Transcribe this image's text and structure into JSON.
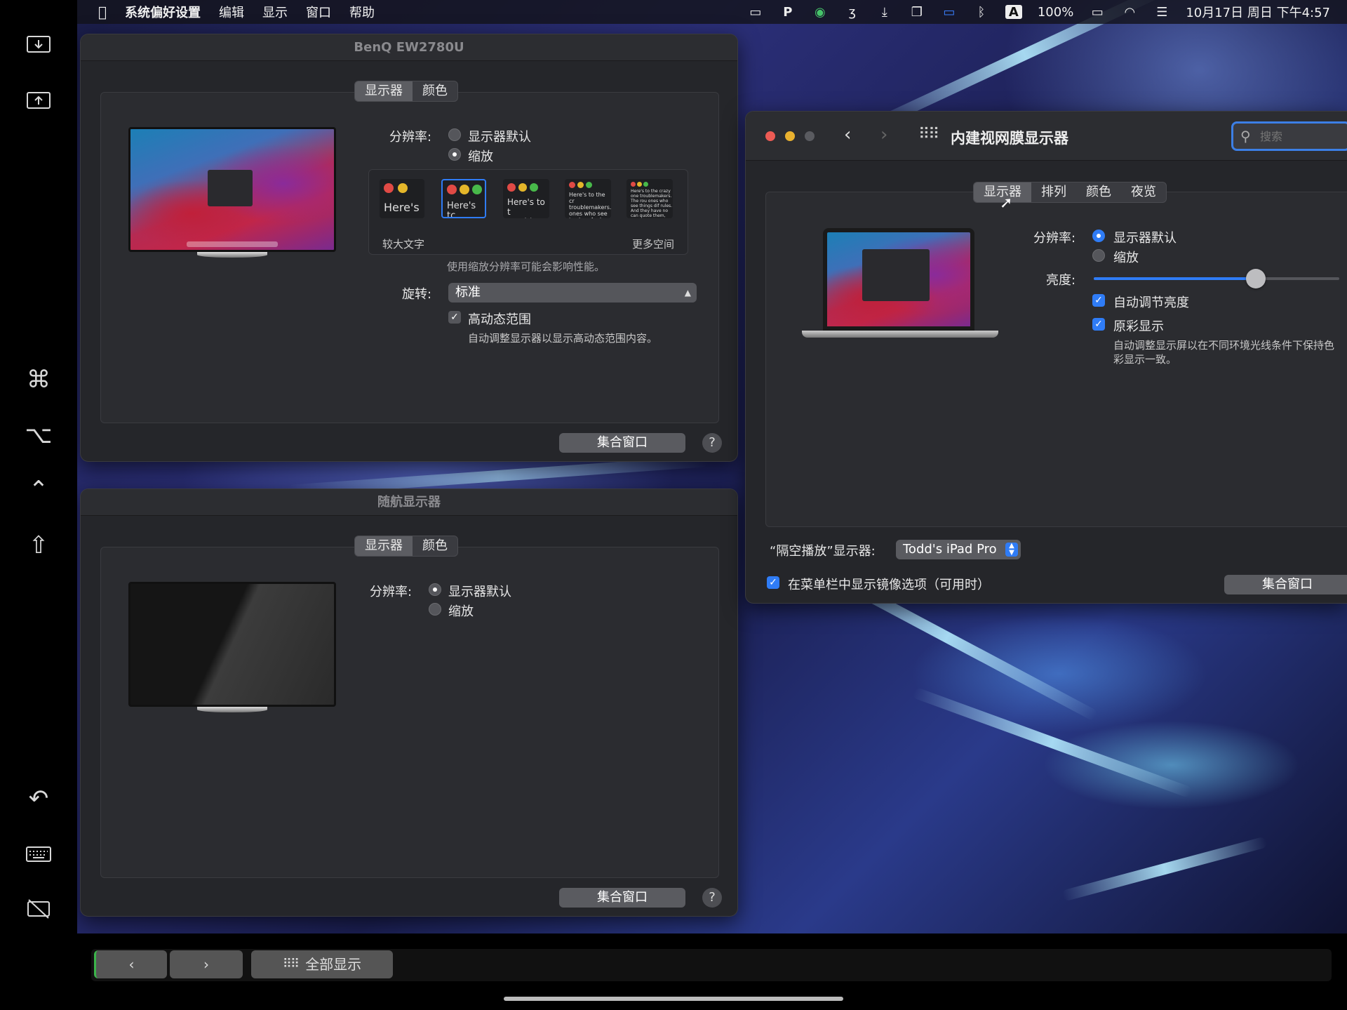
{
  "menubar": {
    "app_name": "系统偏好设置",
    "items": [
      "编辑",
      "显示",
      "窗口",
      "帮助"
    ],
    "battery": "100%",
    "datetime": "10月17日 周日 下午4:57",
    "input_method": "A"
  },
  "benq_window": {
    "title": "BenQ EW2780U",
    "tabs": [
      "显示器",
      "颜色"
    ],
    "resolution_label": "分辨率:",
    "options": [
      "显示器默认",
      "缩放"
    ],
    "scale_left_label": "较大文字",
    "scale_right_label": "更多空间",
    "scale_thumb_texts": [
      "Here's",
      "Here's tc troublem",
      "Here's to t troublema ones who",
      "Here's to the cr troublemakers. ones who see t rules. And they",
      "Here's to the crazy one troublemakers. The rou ones who see things dif rules. And they have no can quote them, disagn Because they change t"
    ],
    "scale_note": "使用缩放分辨率可能会影响性能。",
    "rotation_label": "旋转:",
    "rotation_value": "标准",
    "hdr_label": "高动态范围",
    "hdr_note": "自动调整显示器以显示高动态范围内容。",
    "gather_button": "集合窗口",
    "help": "?"
  },
  "sidecar_window": {
    "title": "随航显示器",
    "tabs": [
      "显示器",
      "颜色"
    ],
    "resolution_label": "分辨率:",
    "options": [
      "显示器默认",
      "缩放"
    ],
    "gather_button": "集合窗口",
    "help": "?"
  },
  "builtin_window": {
    "title": "内建视网膜显示器",
    "search_placeholder": "搜索",
    "tabs": [
      "显示器",
      "排列",
      "颜色",
      "夜览"
    ],
    "resolution_label": "分辨率:",
    "options": [
      "显示器默认",
      "缩放"
    ],
    "brightness_label": "亮度:",
    "brightness_level": 0.66,
    "auto_brightness": "自动调节亮度",
    "true_tone": "原彩显示",
    "true_tone_note_1": "自动调整显示屏以在不同环境光线条件下保持色",
    "true_tone_note_2": "彩显示一致。",
    "airplay_label": "“隔空播放”显示器:",
    "airplay_value": "Todd's iPad Pro",
    "mirror_option": "在菜单栏中显示镜像选项（可用时）",
    "gather_button": "集合窗口"
  },
  "bottom_bar": {
    "back": "‹",
    "forward": "›",
    "show_all": "全部显示"
  }
}
